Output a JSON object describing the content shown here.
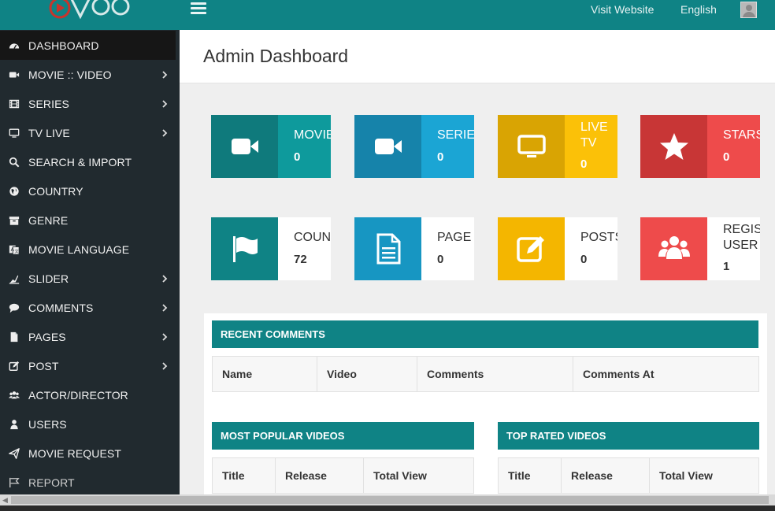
{
  "topbar": {
    "visit_website": "Visit Website",
    "language": "English"
  },
  "sidebar": {
    "items": [
      {
        "label": "DASHBOARD",
        "icon": "dashboard-icon"
      },
      {
        "label": "MOVIE :: VIDEO",
        "icon": "video-camera-icon"
      },
      {
        "label": "SERIES",
        "icon": "film-icon"
      },
      {
        "label": "TV LIVE",
        "icon": "monitor-icon"
      },
      {
        "label": "SEARCH & IMPORT",
        "icon": "search-icon"
      },
      {
        "label": "COUNTRY",
        "icon": "globe-icon"
      },
      {
        "label": "GENRE",
        "icon": "archive-icon"
      },
      {
        "label": "MOVIE LANGUAGE",
        "icon": "language-icon"
      },
      {
        "label": "SLIDER",
        "icon": "slider-icon"
      },
      {
        "label": "COMMENTS",
        "icon": "comment-icon"
      },
      {
        "label": "PAGES",
        "icon": "file-icon"
      },
      {
        "label": "POST",
        "icon": "edit-icon"
      },
      {
        "label": "ACTOR/DIRECTOR",
        "icon": "users-icon"
      },
      {
        "label": "USERS",
        "icon": "user-icon"
      },
      {
        "label": "MOVIE REQUEST",
        "icon": "send-icon"
      },
      {
        "label": "REPORT",
        "icon": "flag-icon"
      }
    ]
  },
  "header": {
    "title": "Admin Dashboard"
  },
  "stats": [
    {
      "label": "MOVIES",
      "value": "0",
      "icon": "video-camera-icon",
      "color": "#0f8385"
    },
    {
      "label": "SERIES",
      "value": "0",
      "icon": "video-camera-icon",
      "color": "#1796c2"
    },
    {
      "label_line1": "LIVE",
      "label_line2": "TV",
      "value": "0",
      "icon": "monitor-icon",
      "color": "#f4b600"
    },
    {
      "label": "STARS",
      "value": "0",
      "icon": "star-icon",
      "color": "#de3e3f"
    },
    {
      "label": "COUNTRIES",
      "value": "72",
      "icon": "flag-icon",
      "color": "#0f8385"
    },
    {
      "label": "PAGE",
      "value": "0",
      "icon": "file-text-icon",
      "color": "#1796c2"
    },
    {
      "label": "POSTS",
      "value": "0",
      "icon": "edit-icon",
      "color": "#f4b600"
    },
    {
      "label_line1": "REGISTERED",
      "label_line2": "USER",
      "value": "1",
      "icon": "users-icon",
      "color": "#de3e3f"
    }
  ],
  "recent_comments": {
    "title": "RECENT COMMENTS",
    "columns": [
      "Name",
      "Video",
      "Comments",
      "Comments At"
    ]
  },
  "most_popular": {
    "title": "MOST POPULAR VIDEOS",
    "columns": [
      "Title",
      "Release",
      "Total View"
    ]
  },
  "top_rated": {
    "title": "TOP RATED VIDEOS",
    "columns": [
      "Title",
      "Release",
      "Total View"
    ]
  }
}
